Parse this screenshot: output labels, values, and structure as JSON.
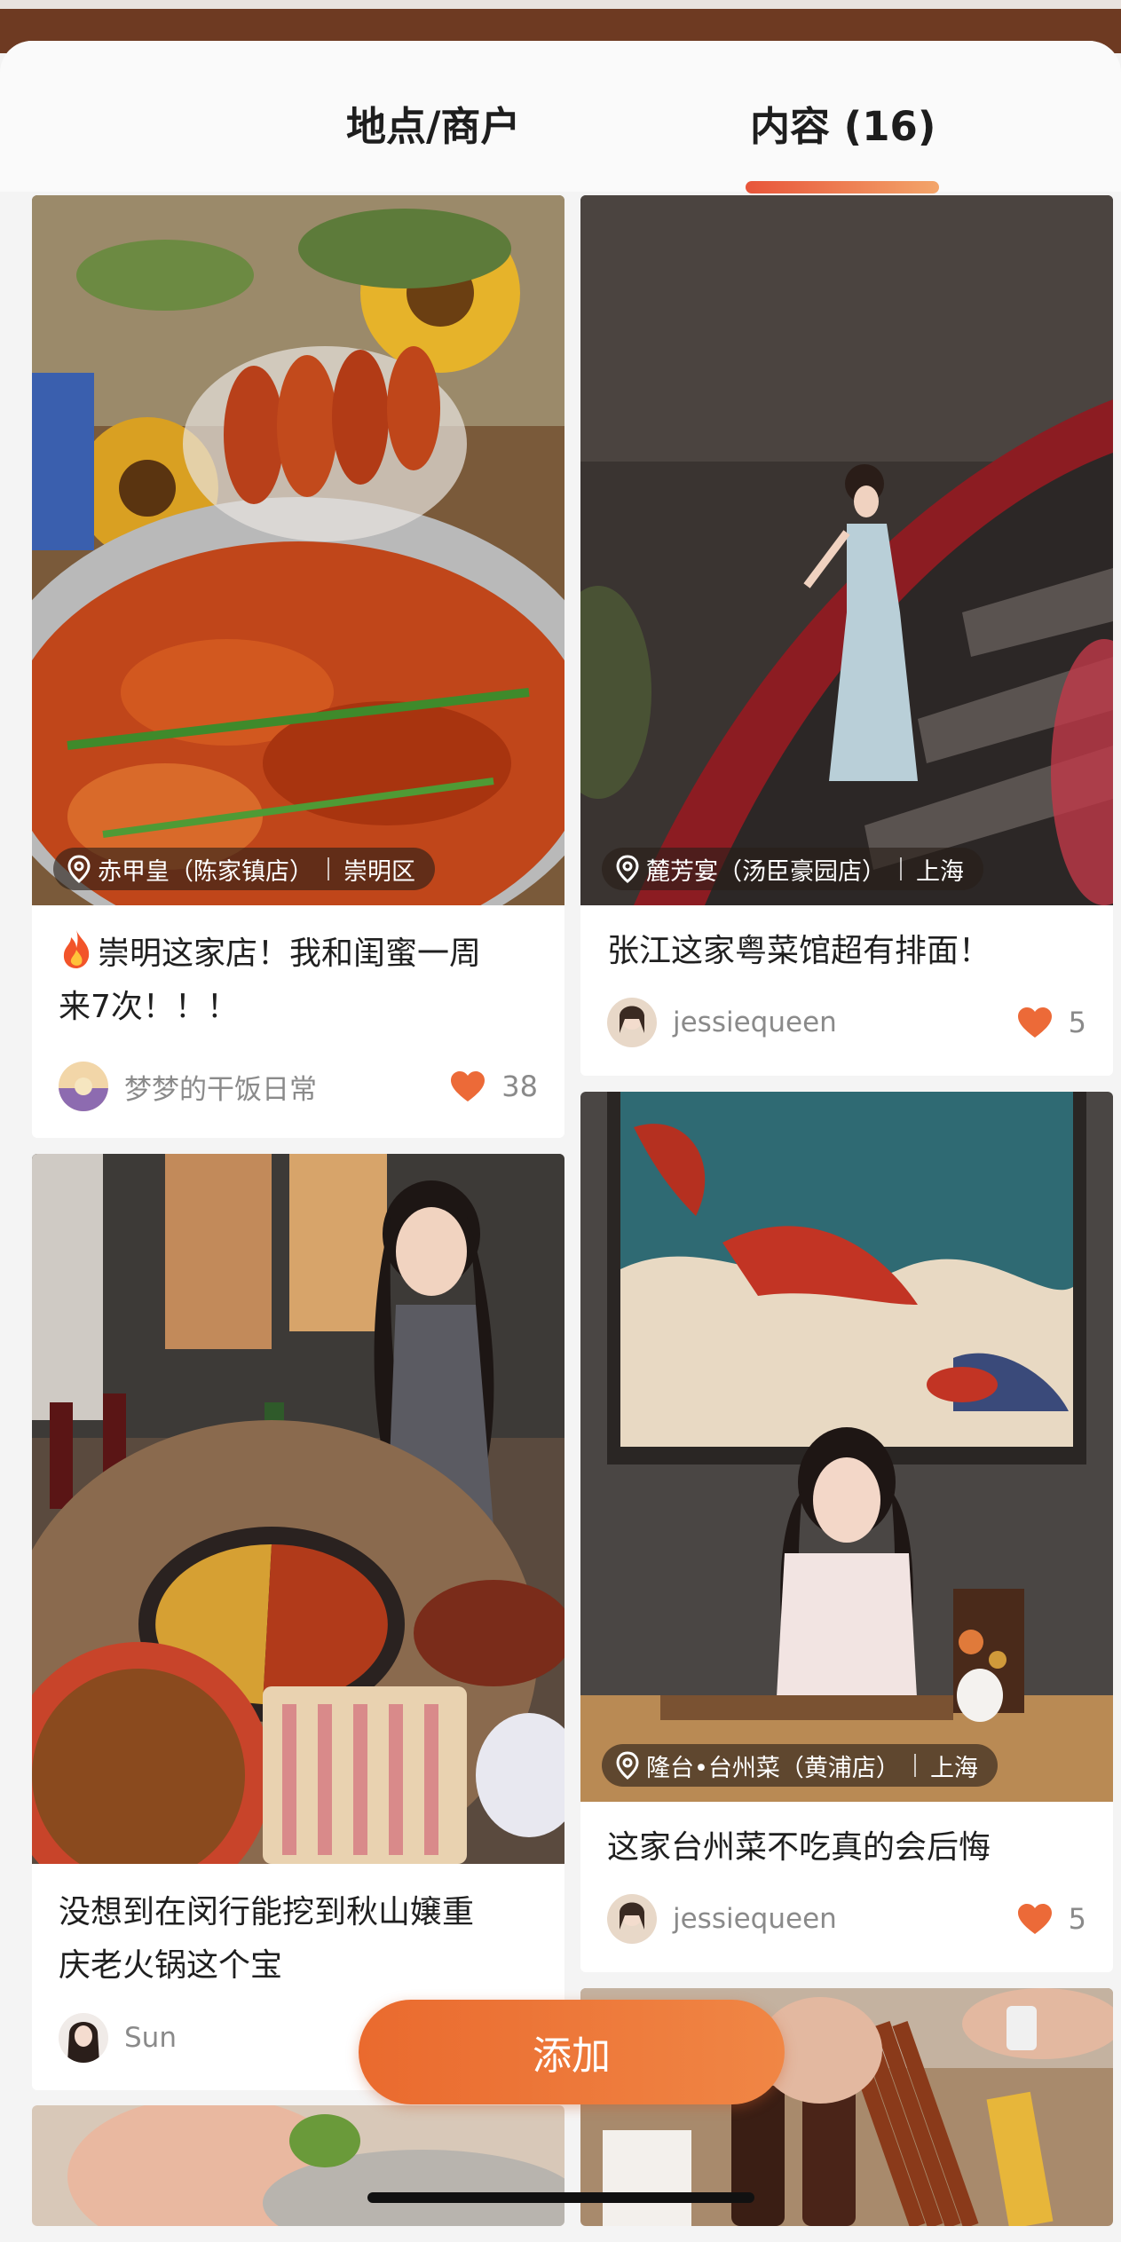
{
  "tabs": [
    {
      "label": "地点/商户",
      "active": false
    },
    {
      "label": "内容 (16)",
      "active": true
    }
  ],
  "colors": {
    "accent": "#ee7436",
    "heart": "#ec6a38",
    "topbar": "#6e3a22"
  },
  "posts": [
    {
      "location": "赤甲皇（陈家镇店）",
      "area": "崇明区",
      "title_line1": "崇明这家店！我和闺蜜一周",
      "title_line2": "来7次！！！",
      "has_fire_emoji": true,
      "author": "梦梦的干饭日常",
      "likes": "38",
      "image": "crayfish-dish-photo"
    },
    {
      "location": "麓芳宴（汤臣豪园店）",
      "area": "上海",
      "title_line1": "张江这家粤菜馆超有排面！",
      "author": "jessiequeen",
      "likes": "5",
      "image": "woman-on-spiral-staircase-photo"
    },
    {
      "title_line1": "没想到在闵行能挖到秋山嬢重",
      "title_line2": "庆老火锅这个宝",
      "author": "Sun",
      "image": "hotpot-table-photo"
    },
    {
      "location": "隆台•台州菜（黄浦店）",
      "area": "上海",
      "title_line1": "这家台州菜不吃真的会后悔",
      "author": "jessiequeen",
      "likes": "5",
      "image": "woman-with-fish-painting-photo"
    },
    {
      "image": "food-photo-partial"
    },
    {
      "image": "skewers-photo-partial"
    }
  ],
  "add_button": {
    "label": "添加"
  }
}
